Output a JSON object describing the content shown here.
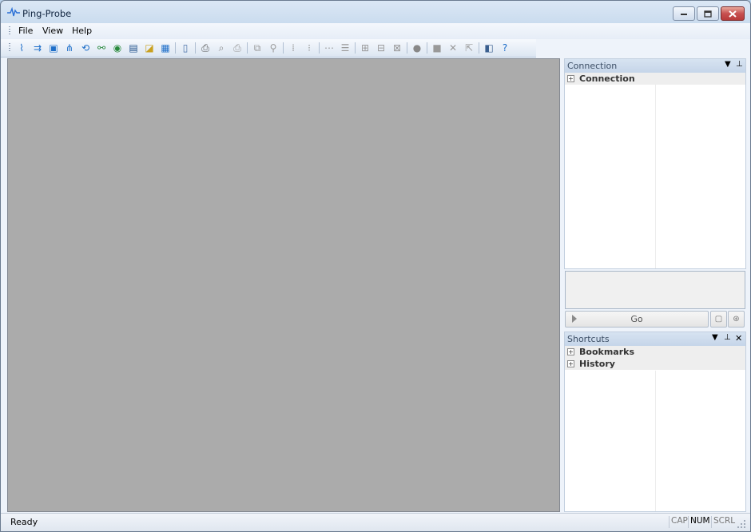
{
  "window": {
    "title": "Ping-Probe"
  },
  "menu": {
    "items": [
      "File",
      "View",
      "Help"
    ]
  },
  "toolbar": {
    "icons": [
      "ping-icon",
      "trace-route-icon",
      "port-scan-icon",
      "network-map-icon",
      "dns-lookup-icon",
      "network-scan-icon",
      "globe-icon",
      "monitor-icon",
      "whois-icon",
      "calculator-icon",
      "|",
      "new-document-icon",
      "|",
      "print-icon",
      "print-preview-icon",
      "printer-icon",
      "|",
      "copy-icon",
      "find-icon",
      "|",
      "expand-icon",
      "collapse-icon",
      "|",
      "connect-icon",
      "list-icon",
      "|",
      "tree-icon",
      "tree-view-icon",
      "tree-split-icon",
      "|",
      "record-icon",
      "|",
      "stop-icon",
      "cancel-icon",
      "export-icon",
      "|",
      "book-icon",
      "help-icon"
    ]
  },
  "connection_panel": {
    "title": "Connection",
    "tree": [
      {
        "label": "Connection",
        "expander": "+"
      }
    ],
    "go_label": "Go"
  },
  "shortcuts_panel": {
    "title": "Shortcuts",
    "tree": [
      {
        "label": "Bookmarks",
        "expander": "+"
      },
      {
        "label": "History",
        "expander": "+"
      }
    ]
  },
  "status": {
    "text": "Ready",
    "indicators": [
      "CAP",
      "NUM",
      "SCRL"
    ]
  }
}
